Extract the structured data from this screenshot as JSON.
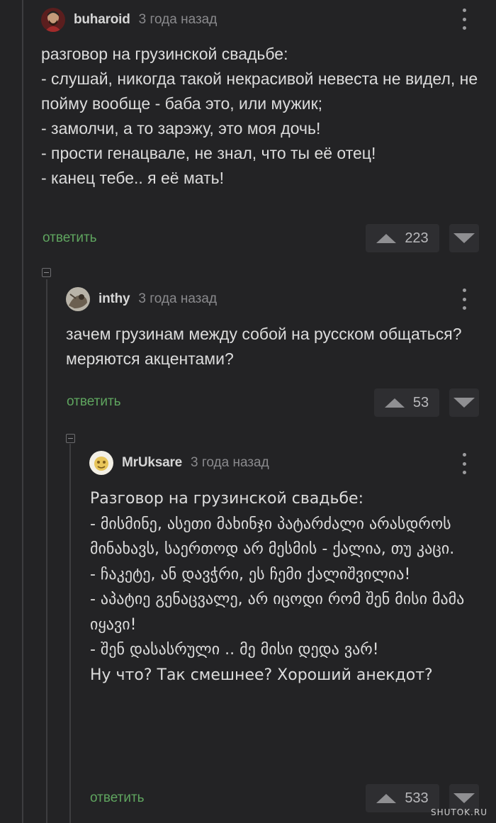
{
  "comments": [
    {
      "author": "buharoid",
      "time": "3 года назад",
      "body": "разговор на грузинской свадьбе:\n- слушай, никогда такой некрасивой невеста не видел, не пойму вообще - баба это, или мужик;\n- замолчи, а то зарэжу, это моя дочь!\n- прости генацвале, не знал, что ты её отец!\n- канец тебе.. я её мать!",
      "reply_label": "ответить",
      "score": "223"
    },
    {
      "author": "inthy",
      "time": "3 года назад",
      "body": "зачем грузинам между собой на русском общаться? меряются акцентами?",
      "reply_label": "ответить",
      "score": "53"
    },
    {
      "author": "MrUksare",
      "time": "3 года назад",
      "body": "Разговор на грузинской свадьбе:\n- მისმინე, ასეთი მახინჯი პატარძალი არასდროს მინახავს, საერთოდ არ მესმის - ქალია, თუ კაცი.\n- ჩაკეტე, ან დავჭრი, ეს ჩემი ქალიშვილია!\n- აპატიე გენაცვალე, არ იცოდი რომ შენ მისი მამა იყავი!\n- შენ დასასრული .. მე მისი დედა ვარ!\nНу что? Так смешнее? Хороший анекдот?",
      "reply_label": "ответить",
      "score": "533"
    }
  ],
  "watermark": "SHUTOK.RU",
  "colors": {
    "background": "#232325",
    "reply_link": "#5fa55f",
    "vote_bg": "#2e2e31"
  },
  "icons": [
    "menu-dots-icon",
    "upvote-icon",
    "downvote-icon",
    "collapse-icon",
    "avatar"
  ]
}
